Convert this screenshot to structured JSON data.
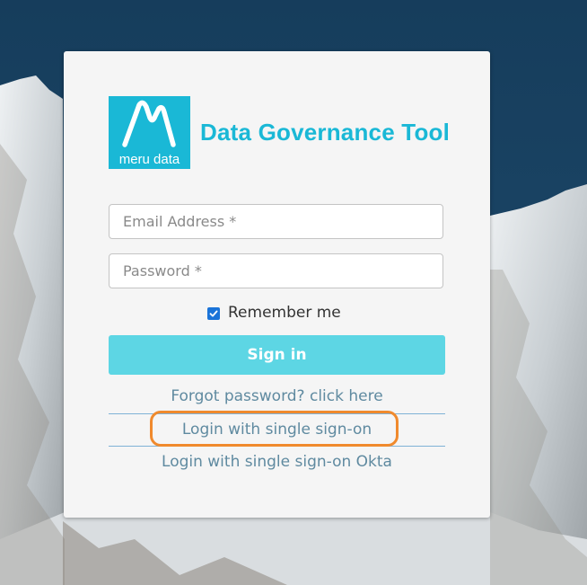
{
  "logo": {
    "text": "meru data"
  },
  "app_title": "Data Governance Tool",
  "form": {
    "email_placeholder": "Email Address *",
    "password_placeholder": "Password *",
    "remember_label": "Remember me",
    "remember_checked": true,
    "signin_label": "Sign in"
  },
  "links": {
    "forgot": "Forgot password? click here",
    "sso": "Login with single sign-on",
    "okta": "Login with single sign-on Okta"
  },
  "colors": {
    "brand": "#1ab8d6",
    "button": "#5dd6e4",
    "link": "#5f8aa0",
    "highlight": "#f08a2d"
  }
}
